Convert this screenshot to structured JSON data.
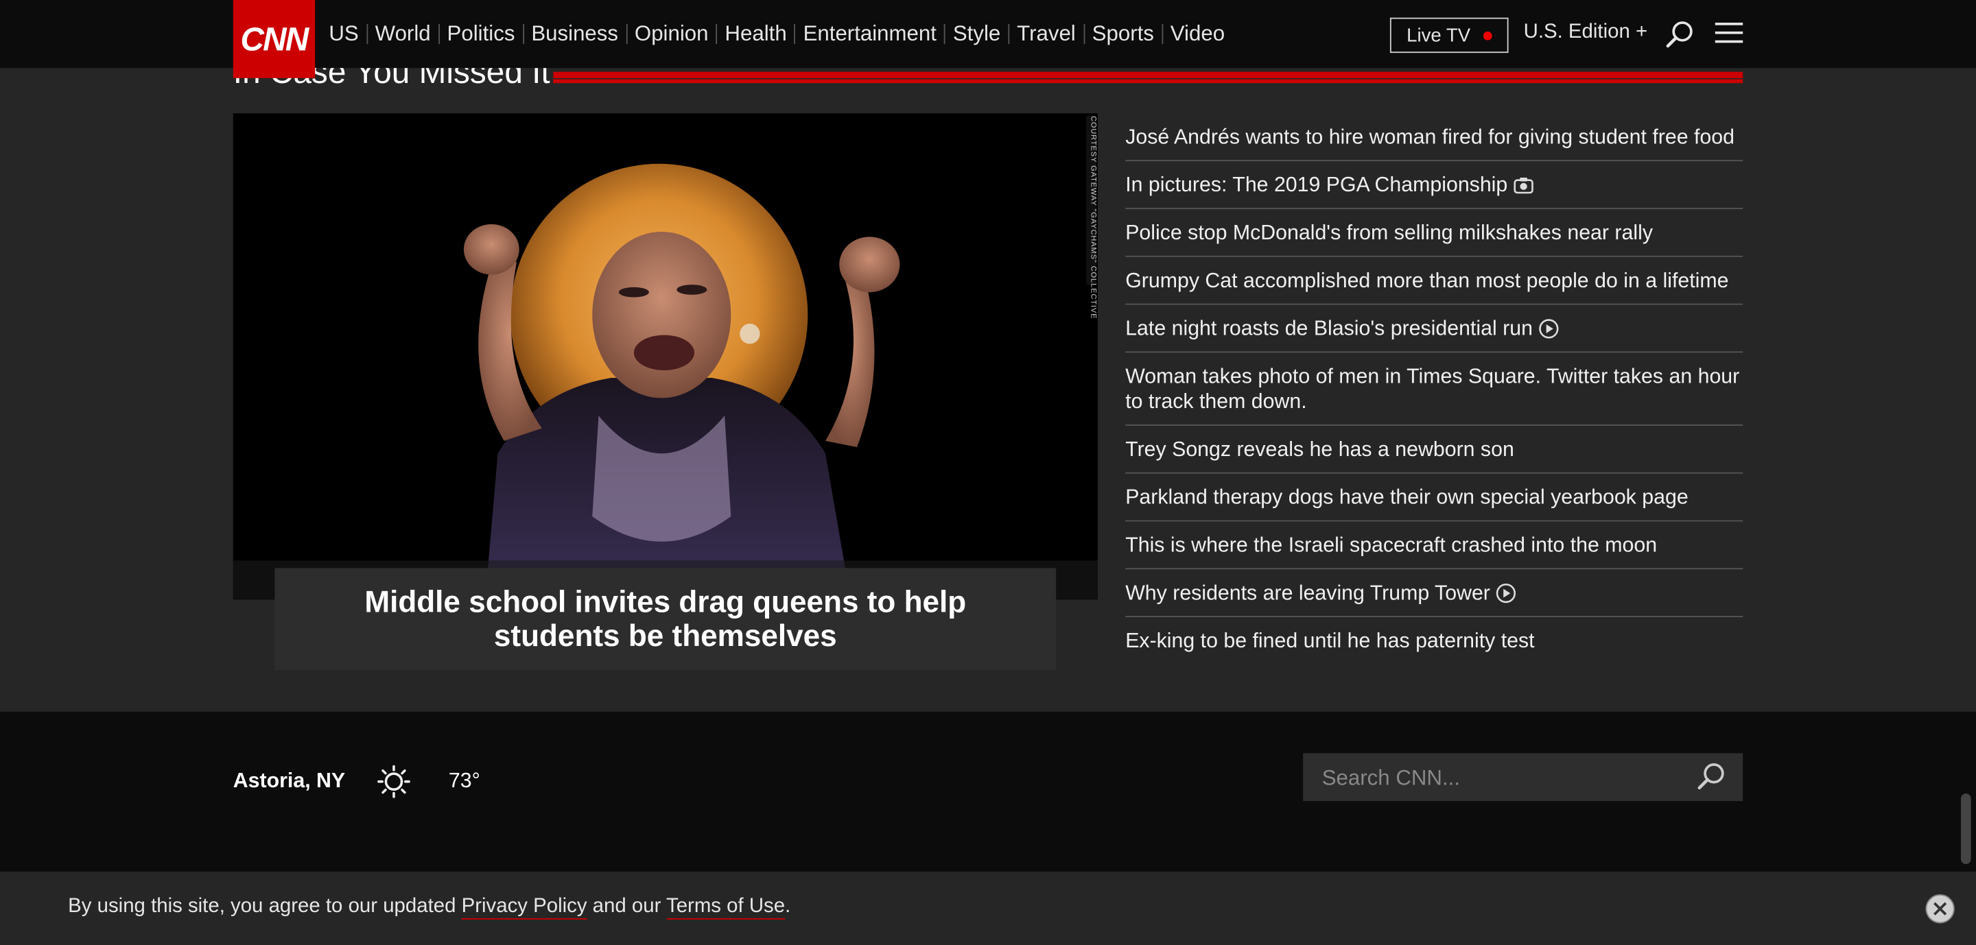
{
  "header": {
    "logo": "CNN",
    "nav": [
      "US",
      "World",
      "Politics",
      "Business",
      "Opinion",
      "Health",
      "Entertainment",
      "Style",
      "Travel",
      "Sports",
      "Video"
    ],
    "live_tv": "Live TV",
    "edition": "U.S. Edition +"
  },
  "section": {
    "title": "In Case You Missed It"
  },
  "hero": {
    "photo_credit": "COURTESY GATEWAY \"GAYCHAMS\" COLLECTIVE",
    "caption": "Middle school invites drag queens to help students be themselves"
  },
  "headlines": [
    {
      "text": "José Andrés wants to hire woman fired for giving student free food",
      "icon": ""
    },
    {
      "text": "In pictures: The 2019 PGA Championship",
      "icon": "camera-icon"
    },
    {
      "text": "Police stop McDonald's from selling milkshakes near rally",
      "icon": ""
    },
    {
      "text": "Grumpy Cat accomplished more than most people do in a lifetime",
      "icon": ""
    },
    {
      "text": "Late night roasts de Blasio's presidential run",
      "icon": "play-icon"
    },
    {
      "text": "Woman takes photo of men in Times Square. Twitter takes an hour to track them down.",
      "icon": ""
    },
    {
      "text": "Trey Songz reveals he has a newborn son",
      "icon": ""
    },
    {
      "text": "Parkland therapy dogs have their own special yearbook page",
      "icon": ""
    },
    {
      "text": "This is where the Israeli spacecraft crashed into the moon",
      "icon": ""
    },
    {
      "text": "Why residents are leaving Trump Tower",
      "icon": "play-icon"
    },
    {
      "text": "Ex-king to be fined until he has paternity test",
      "icon": ""
    }
  ],
  "weather": {
    "location": "Astoria, NY",
    "icon": "sun-icon",
    "temperature": "73°"
  },
  "search": {
    "placeholder": "Search CNN..."
  },
  "cookie": {
    "prefix": "By using this site, you agree to our updated ",
    "privacy_link": "Privacy Policy",
    "middle": " and our ",
    "terms_link": "Terms of Use",
    "suffix": "."
  },
  "colors": {
    "brand_red": "#cc0000",
    "header_bg": "#0c0c0c",
    "page_bg": "#262626"
  }
}
